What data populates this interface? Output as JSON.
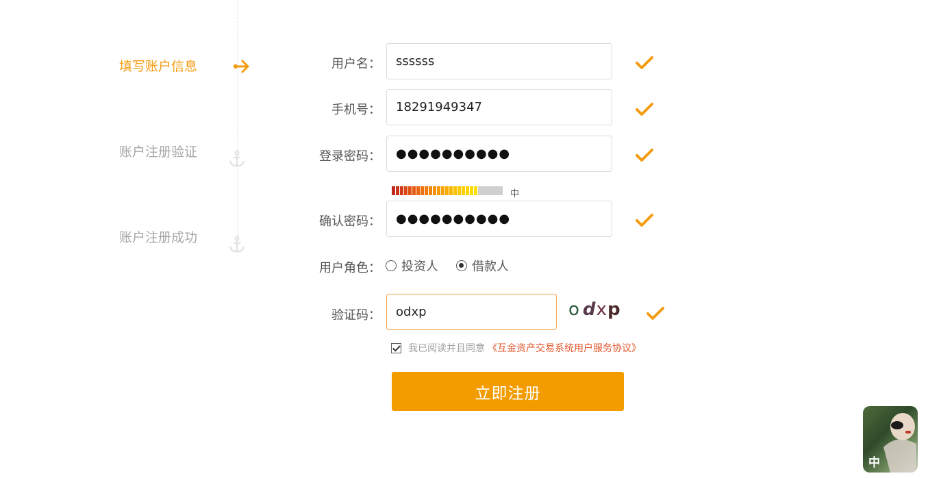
{
  "steps": [
    {
      "label": "填写账户信息",
      "active": true
    },
    {
      "label": "账户注册验证",
      "active": false
    },
    {
      "label": "账户注册成功",
      "active": false
    }
  ],
  "form": {
    "username": {
      "label": "用户名：",
      "value": "ssssss"
    },
    "phone": {
      "label": "手机号：",
      "value": "18291949347"
    },
    "password": {
      "label": "登录密码：",
      "value": "●●●●●●●●●●"
    },
    "strength": {
      "label": "中",
      "level": 0.78
    },
    "confirm": {
      "label": "确认密码：",
      "value": "●●●●●●●●●●"
    },
    "role": {
      "label": "用户角色：",
      "options": [
        "投资人",
        "借款人"
      ],
      "selected": "借款人"
    },
    "captcha": {
      "label": "验证码：",
      "value": "odxp",
      "image_text": [
        "o",
        "d",
        "x",
        "p"
      ]
    },
    "agreement": {
      "text": "我已阅读并且同意",
      "link": "《互金资产交易系统用户服务协议》",
      "checked": true
    },
    "submit": "立即注册"
  },
  "ime_badge": "中",
  "colors": {
    "accent": "#f39c00",
    "link": "#e2552a",
    "muted": "#a8a8a8"
  }
}
